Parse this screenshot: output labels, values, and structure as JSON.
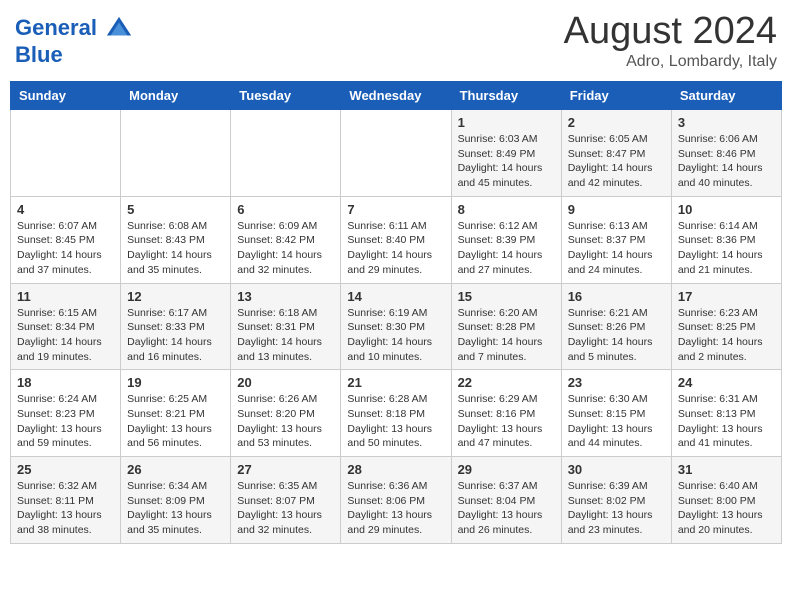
{
  "header": {
    "logo_line1": "General",
    "logo_line2": "Blue",
    "month_year": "August 2024",
    "location": "Adro, Lombardy, Italy"
  },
  "calendar": {
    "days_of_week": [
      "Sunday",
      "Monday",
      "Tuesday",
      "Wednesday",
      "Thursday",
      "Friday",
      "Saturday"
    ],
    "weeks": [
      [
        {
          "day": "",
          "info": ""
        },
        {
          "day": "",
          "info": ""
        },
        {
          "day": "",
          "info": ""
        },
        {
          "day": "",
          "info": ""
        },
        {
          "day": "1",
          "info": "Sunrise: 6:03 AM\nSunset: 8:49 PM\nDaylight: 14 hours\nand 45 minutes."
        },
        {
          "day": "2",
          "info": "Sunrise: 6:05 AM\nSunset: 8:47 PM\nDaylight: 14 hours\nand 42 minutes."
        },
        {
          "day": "3",
          "info": "Sunrise: 6:06 AM\nSunset: 8:46 PM\nDaylight: 14 hours\nand 40 minutes."
        }
      ],
      [
        {
          "day": "4",
          "info": "Sunrise: 6:07 AM\nSunset: 8:45 PM\nDaylight: 14 hours\nand 37 minutes."
        },
        {
          "day": "5",
          "info": "Sunrise: 6:08 AM\nSunset: 8:43 PM\nDaylight: 14 hours\nand 35 minutes."
        },
        {
          "day": "6",
          "info": "Sunrise: 6:09 AM\nSunset: 8:42 PM\nDaylight: 14 hours\nand 32 minutes."
        },
        {
          "day": "7",
          "info": "Sunrise: 6:11 AM\nSunset: 8:40 PM\nDaylight: 14 hours\nand 29 minutes."
        },
        {
          "day": "8",
          "info": "Sunrise: 6:12 AM\nSunset: 8:39 PM\nDaylight: 14 hours\nand 27 minutes."
        },
        {
          "day": "9",
          "info": "Sunrise: 6:13 AM\nSunset: 8:37 PM\nDaylight: 14 hours\nand 24 minutes."
        },
        {
          "day": "10",
          "info": "Sunrise: 6:14 AM\nSunset: 8:36 PM\nDaylight: 14 hours\nand 21 minutes."
        }
      ],
      [
        {
          "day": "11",
          "info": "Sunrise: 6:15 AM\nSunset: 8:34 PM\nDaylight: 14 hours\nand 19 minutes."
        },
        {
          "day": "12",
          "info": "Sunrise: 6:17 AM\nSunset: 8:33 PM\nDaylight: 14 hours\nand 16 minutes."
        },
        {
          "day": "13",
          "info": "Sunrise: 6:18 AM\nSunset: 8:31 PM\nDaylight: 14 hours\nand 13 minutes."
        },
        {
          "day": "14",
          "info": "Sunrise: 6:19 AM\nSunset: 8:30 PM\nDaylight: 14 hours\nand 10 minutes."
        },
        {
          "day": "15",
          "info": "Sunrise: 6:20 AM\nSunset: 8:28 PM\nDaylight: 14 hours\nand 7 minutes."
        },
        {
          "day": "16",
          "info": "Sunrise: 6:21 AM\nSunset: 8:26 PM\nDaylight: 14 hours\nand 5 minutes."
        },
        {
          "day": "17",
          "info": "Sunrise: 6:23 AM\nSunset: 8:25 PM\nDaylight: 14 hours\nand 2 minutes."
        }
      ],
      [
        {
          "day": "18",
          "info": "Sunrise: 6:24 AM\nSunset: 8:23 PM\nDaylight: 13 hours\nand 59 minutes."
        },
        {
          "day": "19",
          "info": "Sunrise: 6:25 AM\nSunset: 8:21 PM\nDaylight: 13 hours\nand 56 minutes."
        },
        {
          "day": "20",
          "info": "Sunrise: 6:26 AM\nSunset: 8:20 PM\nDaylight: 13 hours\nand 53 minutes."
        },
        {
          "day": "21",
          "info": "Sunrise: 6:28 AM\nSunset: 8:18 PM\nDaylight: 13 hours\nand 50 minutes."
        },
        {
          "day": "22",
          "info": "Sunrise: 6:29 AM\nSunset: 8:16 PM\nDaylight: 13 hours\nand 47 minutes."
        },
        {
          "day": "23",
          "info": "Sunrise: 6:30 AM\nSunset: 8:15 PM\nDaylight: 13 hours\nand 44 minutes."
        },
        {
          "day": "24",
          "info": "Sunrise: 6:31 AM\nSunset: 8:13 PM\nDaylight: 13 hours\nand 41 minutes."
        }
      ],
      [
        {
          "day": "25",
          "info": "Sunrise: 6:32 AM\nSunset: 8:11 PM\nDaylight: 13 hours\nand 38 minutes."
        },
        {
          "day": "26",
          "info": "Sunrise: 6:34 AM\nSunset: 8:09 PM\nDaylight: 13 hours\nand 35 minutes."
        },
        {
          "day": "27",
          "info": "Sunrise: 6:35 AM\nSunset: 8:07 PM\nDaylight: 13 hours\nand 32 minutes."
        },
        {
          "day": "28",
          "info": "Sunrise: 6:36 AM\nSunset: 8:06 PM\nDaylight: 13 hours\nand 29 minutes."
        },
        {
          "day": "29",
          "info": "Sunrise: 6:37 AM\nSunset: 8:04 PM\nDaylight: 13 hours\nand 26 minutes."
        },
        {
          "day": "30",
          "info": "Sunrise: 6:39 AM\nSunset: 8:02 PM\nDaylight: 13 hours\nand 23 minutes."
        },
        {
          "day": "31",
          "info": "Sunrise: 6:40 AM\nSunset: 8:00 PM\nDaylight: 13 hours\nand 20 minutes."
        }
      ]
    ]
  }
}
